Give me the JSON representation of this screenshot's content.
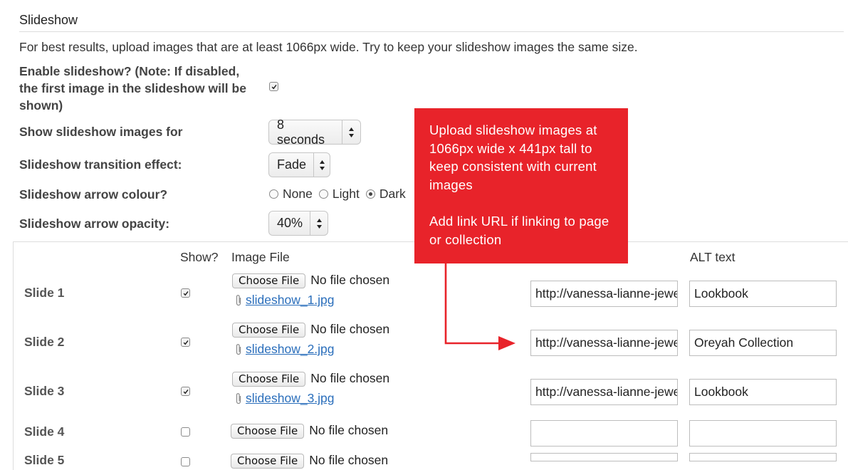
{
  "section": {
    "title": "Slideshow",
    "intro": "For best results, upload images that are at least 1066px wide. Try to keep your slideshow images the same size."
  },
  "settings": {
    "enable_label": "Enable slideshow? (Note: If disabled, the first image in the slideshow will be shown)",
    "enable_checked": true,
    "duration_label": "Show slideshow images for",
    "duration_value": "8 seconds",
    "effect_label": "Slideshow transition effect:",
    "effect_value": "Fade",
    "arrow_colour_label": "Slideshow arrow colour?",
    "arrow_colour_options": [
      "None",
      "Light",
      "Dark"
    ],
    "arrow_colour_selected": "Dark",
    "opacity_label": "Slideshow arrow opacity:",
    "opacity_value": "40%"
  },
  "table": {
    "col_show": "Show?",
    "col_image": "Image File",
    "col_alt": "ALT text",
    "choose_file_label": "Choose File",
    "no_file_text": "No file chosen",
    "slides": [
      {
        "label": "Slide 1",
        "show": true,
        "file": "slideshow_1.jpg",
        "url": "http://vanessa-lianne-jewellery",
        "alt": "Lookbook"
      },
      {
        "label": "Slide 2",
        "show": true,
        "file": "slideshow_2.jpg",
        "url": "http://vanessa-lianne-jewellery",
        "alt": "Oreyah Collection"
      },
      {
        "label": "Slide 3",
        "show": true,
        "file": "slideshow_3.jpg",
        "url": "http://vanessa-lianne-jewellery",
        "alt": "Lookbook"
      },
      {
        "label": "Slide 4",
        "show": false,
        "file": "",
        "url": "",
        "alt": ""
      },
      {
        "label": "Slide 5",
        "show": false,
        "file": "",
        "url": "",
        "alt": ""
      }
    ]
  },
  "callout": {
    "line1": "Upload slideshow images at 1066px wide x 441px tall to keep consistent with current images",
    "line2": "Add link URL if linking to page or collection",
    "color": "#e8232a"
  }
}
